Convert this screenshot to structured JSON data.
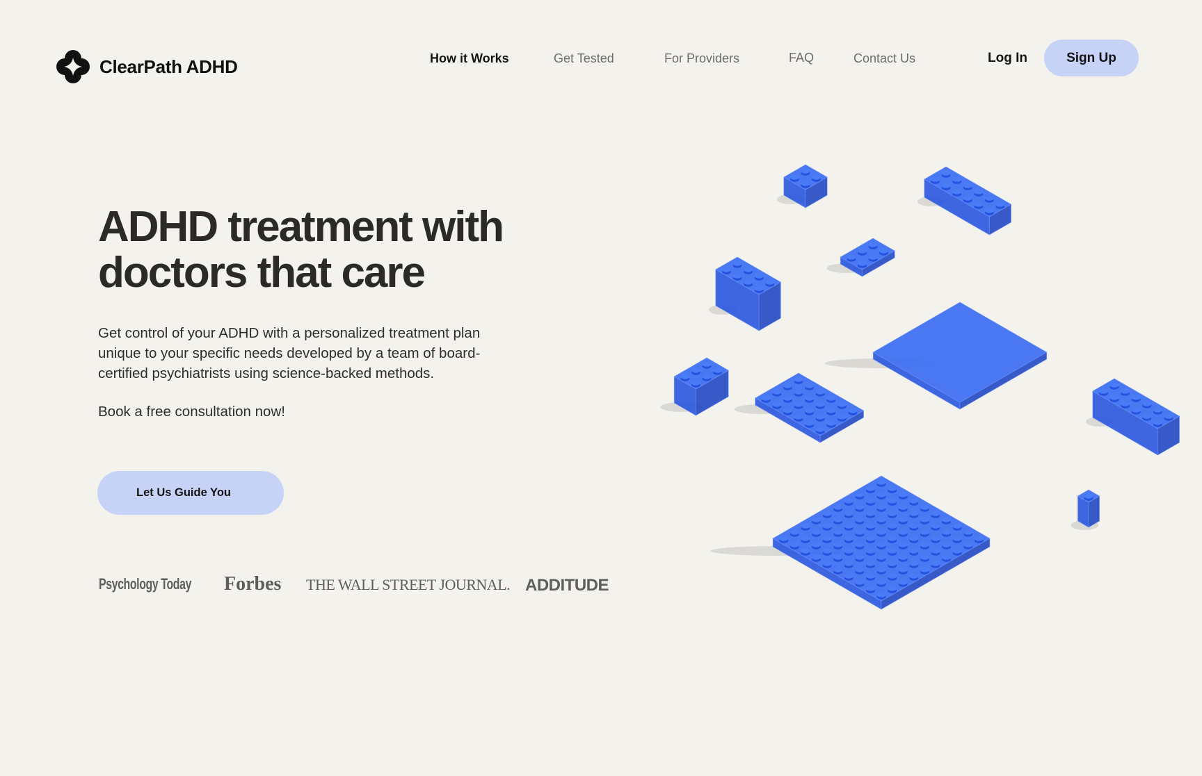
{
  "brand": {
    "name": "ClearPath ADHD"
  },
  "nav": {
    "items": [
      {
        "label": "How it Works",
        "active": true
      },
      {
        "label": "Get Tested"
      },
      {
        "label": "For Providers"
      },
      {
        "label": "FAQ"
      },
      {
        "label": "Contact Us"
      }
    ],
    "login_label": "Log In",
    "signup_label": "Sign Up"
  },
  "hero": {
    "headline": "ADHD treatment with doctors that care",
    "description": "Get control of your ADHD with a personalized treatment plan unique to your specific needs developed by a team of board-certified psychiatrists using science-backed methods.",
    "cta_text": "Book a free consultation now!",
    "button_label": "Let Us Guide You"
  },
  "press": [
    "Psychology Today",
    "Forbes",
    "THE WALL STREET JOURNAL.",
    "ADDITUDE"
  ],
  "colors": {
    "background": "#f3f2ed",
    "button": "#c7d2f7",
    "brick_top": "#3b6ef2",
    "brick_left": "#2452de",
    "brick_right": "#1e44c4"
  },
  "illustration": {
    "icon": "blue-building-blocks"
  }
}
